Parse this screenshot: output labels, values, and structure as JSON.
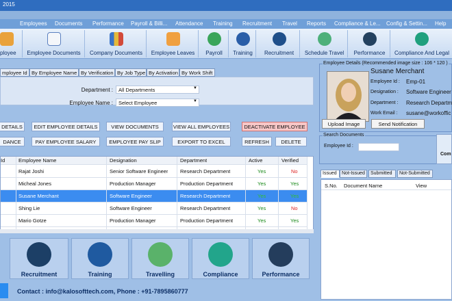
{
  "titlebar": {
    "text": "2015"
  },
  "menu": [
    "Employees",
    "Documents",
    "Performance",
    "Payroll & Billi...",
    "Attendance",
    "Training",
    "Recruitment",
    "Travel",
    "Reports",
    "Compliance & Le...",
    "Config & Settin...",
    "Help"
  ],
  "ribbon": [
    {
      "label": "ployee",
      "icon": "add-employee-icon"
    },
    {
      "label": "Employee Documents",
      "icon": "documents-icon"
    },
    {
      "label": "Company Documents",
      "icon": "binders-icon"
    },
    {
      "label": "Employee Leaves",
      "icon": "presentation-icon"
    },
    {
      "label": "Payroll",
      "icon": "payroll-icon"
    },
    {
      "label": "Training",
      "icon": "training-icon"
    },
    {
      "label": "Recruitment",
      "icon": "recruitment-icon"
    },
    {
      "label": "Schedule Travel",
      "icon": "travel-icon"
    },
    {
      "label": "Performance",
      "icon": "performance-icon"
    },
    {
      "label": "Compliance And Legal",
      "icon": "gavel-icon"
    }
  ],
  "filter_tabs": [
    "mployee Id",
    "By Employee Name",
    "By Verification",
    "By Job Type",
    "By Activation",
    "By Work Shift"
  ],
  "filter": {
    "department_label": "Department :",
    "department_value": "All Departments",
    "employee_label": "Employee Name :",
    "employee_value": "Select Employee"
  },
  "actions": {
    "details": "DETAILS",
    "edit": "EDIT EMPLOYEE DETAILS",
    "view_docs": "VIEW DOCUMENTS",
    "view_all": "VIEW ALL EMPLOYEES",
    "deactivate": "DEACTIVATE EMPLOYEE",
    "dance": "DANCE",
    "pay_salary": "PAY EMPLOYEE SALARY",
    "pay_slip": "EMPLOYEE PAY SLIP",
    "export": "EXPORT TO EXCEL",
    "refresh": "REFRESH",
    "delete": "DELETE"
  },
  "grid": {
    "headers": [
      "Id",
      "Employee Name",
      "Designation",
      "Department",
      "Active",
      "Verified"
    ],
    "rows": [
      {
        "name": "Rajat Joshi",
        "designation": "Senior Software Engineer",
        "department": "Research Department",
        "active": "Yes",
        "verified": "No"
      },
      {
        "name": "Micheal Jones",
        "designation": "Production Manager",
        "department": "Production Department",
        "active": "Yes",
        "verified": "Yes"
      },
      {
        "name": "Susane Merchant",
        "designation": "Software Engineer",
        "department": "Research Department",
        "active": "Yes",
        "verified": "Yes"
      },
      {
        "name": "Shing Lie",
        "designation": "Software Engineer",
        "department": "Research Department",
        "active": "Yes",
        "verified": "No"
      },
      {
        "name": "Mario Gotze",
        "designation": "Production Manager",
        "department": "Production Department",
        "active": "Yes",
        "verified": "Yes"
      }
    ]
  },
  "tiles": [
    "Recruitment",
    "Training",
    "Travelling",
    "Compliance",
    "Performance"
  ],
  "contact": "Contact : info@kalosofttech.com, Phone : +91-7895860777",
  "details": {
    "caption": "Employee Details (Recommended image size : 106 * 120 )",
    "name": "Susane Merchant",
    "id_label": "Employee Id :",
    "id_value": "Emp-01",
    "designation_label": "Designation :",
    "designation_value": "Software Engineer",
    "department_label": "Department :",
    "department_value": "Research Departm",
    "email_label": "Work Email :",
    "email_value": "susane@workoffic",
    "upload": "Upload Image",
    "notify": "Send Notification"
  },
  "search_docs": {
    "caption": "Search Documents",
    "id_label": "Employee Id :",
    "side_label": "Com"
  },
  "doc_tabs": [
    "Issued",
    "Not-Issued",
    "Submitted",
    "Not-Submitted"
  ],
  "doc_headers": [
    "S.No.",
    "Document Name",
    "View"
  ],
  "colors": {
    "accent": "#3b8cf0",
    "deactivate": "#f8c7c7"
  }
}
